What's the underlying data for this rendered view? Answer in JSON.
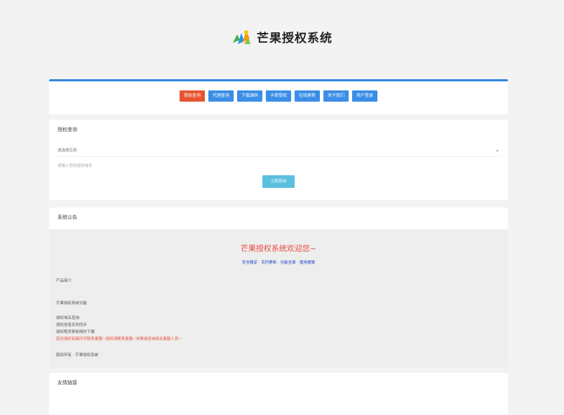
{
  "brand": {
    "title": "芒果授权系统",
    "logo_icon": "mango-logo-icon"
  },
  "nav": {
    "items": [
      {
        "label": "授权查询",
        "active": true
      },
      {
        "label": "代理查询",
        "active": false
      },
      {
        "label": "下载源码",
        "active": false
      },
      {
        "label": "卡密授权",
        "active": false
      },
      {
        "label": "在线更新",
        "active": false
      },
      {
        "label": "关于我们",
        "active": false
      },
      {
        "label": "用户登录",
        "active": false
      }
    ]
  },
  "query": {
    "heading": "授权查询",
    "select_value": "请选择应用",
    "input_placeholder": "请输入您的授权域名",
    "button_label": "立即查询"
  },
  "notice": {
    "heading": "系统公告",
    "welcome": "芒果授权系统欢迎您~",
    "tagline": "安全稳定 · 实时更新 · 功能全面 · 使用便捷",
    "intro_label": "产品简介",
    "lines": [
      "芒果授权系统功能",
      "授权域名查询",
      "授权信息实时同步",
      "授权程序更新随时下载"
    ],
    "red_line": "若对授权有疑问可联系客服~授权请联系客服~详情请咨询相关客服人员~",
    "footer_line": "版权所有 · 芒果授权系统"
  },
  "links": {
    "heading": "友情链接"
  },
  "colors": {
    "accent": "#2e86de",
    "active": "#e8542f",
    "nav_btn": "#3a8ee6",
    "query_btn": "#5bc0de",
    "welcome": "#e84b3c"
  }
}
